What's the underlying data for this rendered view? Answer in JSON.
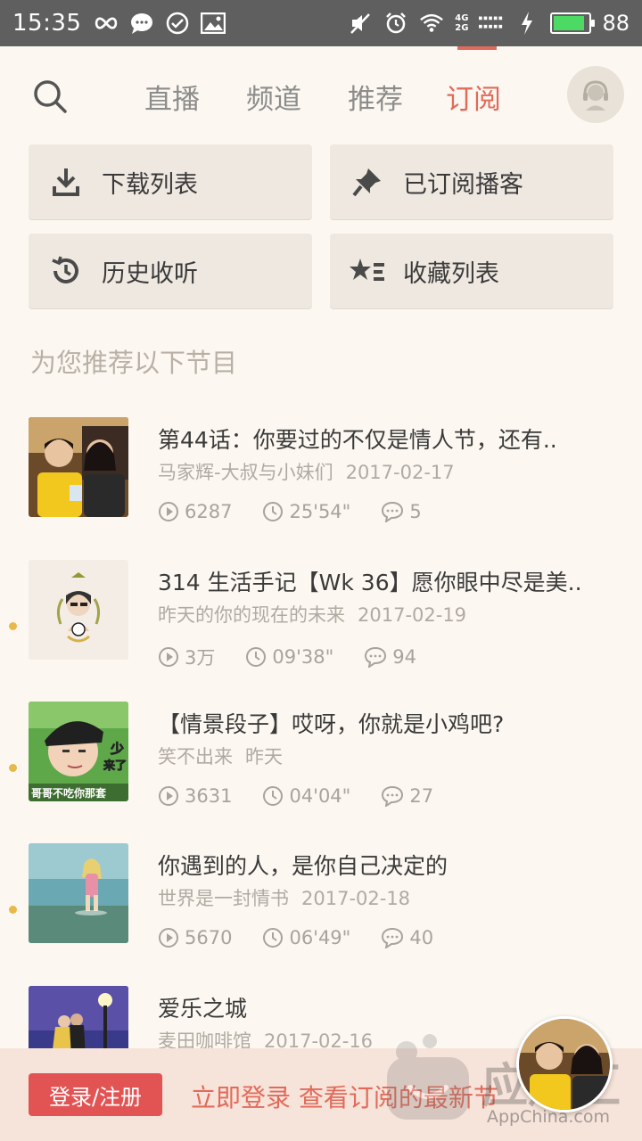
{
  "status_bar": {
    "time": "15:35",
    "battery": "88",
    "battery_level": 0.88,
    "net_top": "4G",
    "net_bottom": "2G"
  },
  "nav": {
    "tabs": [
      {
        "label": "直播"
      },
      {
        "label": "频道"
      },
      {
        "label": "推荐"
      },
      {
        "label": "订阅"
      }
    ],
    "active_tab": "订阅",
    "accent_color": "#e26a5a"
  },
  "quick_actions": [
    {
      "label": "下载列表",
      "icon": "download-icon"
    },
    {
      "label": "已订阅播客",
      "icon": "pin-icon"
    },
    {
      "label": "历史收听",
      "icon": "history-icon"
    },
    {
      "label": "收藏列表",
      "icon": "star-list-icon"
    }
  ],
  "section_title": "为您推荐以下节目",
  "items": [
    {
      "title": "第44话：你要过的不仅是情人节，还有..",
      "author": "马家辉-大叔与小妹们",
      "date": "2017-02-17",
      "plays": "6287",
      "duration": "25'54\"",
      "comments": "5",
      "unread": false
    },
    {
      "title": "314 生活手记【Wk 36】愿你眼中尽是美..",
      "author": "昨天的你的现在的未来",
      "date": "2017-02-19",
      "plays": "3万",
      "duration": "09'38\"",
      "comments": "94",
      "unread": true
    },
    {
      "title": "【情景段子】哎呀，你就是小鸡吧?",
      "author": "笑不出来",
      "date": "昨天",
      "plays": "3631",
      "duration": "04'04\"",
      "comments": "27",
      "unread": true
    },
    {
      "title": "你遇到的人，是你自己决定的",
      "author": "世界是一封情书",
      "date": "2017-02-18",
      "plays": "5670",
      "duration": "06'49\"",
      "comments": "40",
      "unread": true
    },
    {
      "title": "爱乐之城",
      "author": "麦田咖啡馆",
      "date": "2017-02-16",
      "unread": true
    }
  ],
  "thumb_texts": {
    "item3_a": "少",
    "item3_b": "来了",
    "item3_c": "哥哥不吃你那套"
  },
  "bottom": {
    "login_label": "登录/注册",
    "hint": "立即登录 查看订阅的最新节",
    "watermark": "应用汇",
    "watermark_sub": "AppChina.com"
  }
}
